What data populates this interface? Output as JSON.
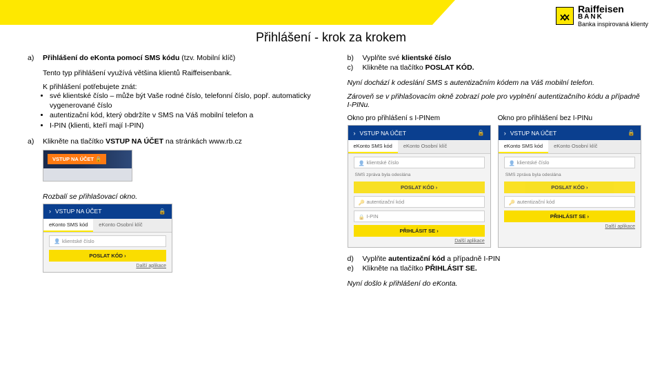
{
  "brand": {
    "name": "Raiffeisen",
    "sub": "BANK",
    "tagline": "Banka inspirovaná klienty"
  },
  "page_title": "Přihlášení - krok za krokem",
  "left": {
    "a_marker": "a)",
    "a_title_plain": "Přihlášení do eKonta pomocí SMS kódu ",
    "a_title_note": "(tzv. Mobilní klíč)",
    "a_sub": "Tento typ přihlášení využívá většina klientů Raiffeisenbank.",
    "need": "K přihlášení potřebujete znát:",
    "bullets": [
      "své klientské číslo – může být Vaše rodné číslo, telefonní číslo, popř. automaticky vygenerované číslo",
      "autentizační kód, který obdržíte v SMS na Váš mobilní telefon a",
      "I-PIN (klienti, kteří mají I-PIN)"
    ],
    "step_a_marker": "a)",
    "step_a_pre": "Klikněte na tlačítko ",
    "step_a_btn": "VSTUP NA ÚČET",
    "step_a_post": " na stránkách www.rb.cz",
    "mock_small_btn": "VSTUP NA ÚČET",
    "mock_small_lock": "🔒",
    "rozbalí": "Rozbalí se přihlašovací okno.",
    "mock_left": {
      "header": "VSTUP NA ÚČET",
      "tab1": "eKonto SMS kód",
      "tab2": "eKonto Osobní klíč",
      "field1": "klientské číslo",
      "btn": "POSLAT KÓD",
      "footer": "Další aplikace"
    }
  },
  "right": {
    "b_marker": "b)",
    "b_text_pre": "Vyplňte své ",
    "b_text_bold": "klientské číslo",
    "c_marker": "c)",
    "c_text_pre": "Klikněte na tlačítko ",
    "c_text_bold": "POSLAT KÓD.",
    "sms_sent": "Nyní dochází k odeslání SMS s autentizačním kódem na Váš mobilní telefon.",
    "zaroven": "Zároveň se v přihlašovacím okně zobrazí pole pro vyplnění autentizačního kódu a případně I-PINu.",
    "caption_ipin": "Okno pro přihlášení s I-PINem",
    "caption_noipin": "Okno pro přihlášení bez I-PINu",
    "mock": {
      "header": "VSTUP NA ÚČET",
      "tab1": "eKonto SMS kód",
      "tab2": "eKonto Osobní klíč",
      "field_client": "klientské číslo",
      "sms_note": "SMS zpráva byla odeslána",
      "btn_send": "POSLAT KÓD",
      "field_auth": "autentizační kód",
      "field_ipin": "I-PIN",
      "btn_login": "PŘIHLÁSIT SE",
      "footer": "Další aplikace"
    },
    "d_marker": "d)",
    "d_pre": "Vyplňte ",
    "d_bold": "autentizační kód",
    "d_post": " a případně I-PIN",
    "e_marker": "e)",
    "e_pre": "Klikněte na tlačítko ",
    "e_bold": "PŘIHLÁSIT SE.",
    "done": "Nyní došlo k přihlášení do eKonta."
  }
}
